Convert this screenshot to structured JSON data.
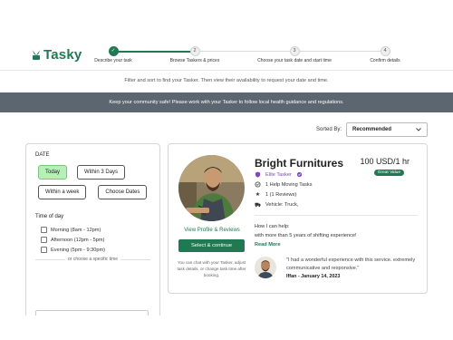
{
  "brand": {
    "name": "Tasky",
    "color": "#1f7a54"
  },
  "steps": [
    {
      "number": "✓",
      "label": "Describe your task",
      "state": "done"
    },
    {
      "number": "2",
      "label": "Browse Taskers & prices",
      "state": "current"
    },
    {
      "number": "3",
      "label": "Choose your task date and start time",
      "state": "upcoming"
    },
    {
      "number": "4",
      "label": "Confirm details",
      "state": "upcoming"
    }
  ],
  "intro_text": "Filter and sort to find your Tasker. Then view their availability to request your date and time.",
  "banner_text": "Keep your community safe! Please work with your Tasker to follow local health guidance and regulations.",
  "sort": {
    "label": "Sorted By:",
    "selected": "Recommended"
  },
  "filters": {
    "date_title": "DATE",
    "date_options": [
      {
        "label": "Today",
        "selected": true
      },
      {
        "label": "Within 3 Days",
        "selected": false
      },
      {
        "label": "Within a week",
        "selected": false
      },
      {
        "label": "Choose Dates",
        "selected": false
      }
    ],
    "time_title": "Time of day",
    "time_options": [
      {
        "label": "Morning (8am - 12pm)"
      },
      {
        "label": "Afternoon (12pm - 5pm)"
      },
      {
        "label": "Evening (5pm - 9:30pm)"
      }
    ],
    "or_text": "or choose a specific time"
  },
  "tasker": {
    "name": "Bright Furnitures",
    "price": "100 USD/1 hr",
    "badge": "Great Value",
    "elite_label": "Elite Tasker",
    "tasks": "1 Help Moving Tasks",
    "reviews": "1 (1 Reviews)",
    "vehicle": "Vehicle: Truck,",
    "profile_link": "View Profile & Reviews",
    "select_button": "Select & continue",
    "chat_note": "You can chat with your Tasker, adjust task details, or change task time after booking.",
    "help_title": "How I can help:",
    "help_text": "with more than 5 years of shifting experience!",
    "read_more": "Read More",
    "review_text": "\"I had a wonderful experience with this service. extremely communicative and responsive.\"",
    "review_author": "Iffan - January 14, 2023"
  },
  "icons": [
    "leaf-logo-icon",
    "check-icon",
    "shield-icon",
    "verified-icon",
    "check-circle-icon",
    "star-icon",
    "truck-icon",
    "chevron-down-icon"
  ]
}
